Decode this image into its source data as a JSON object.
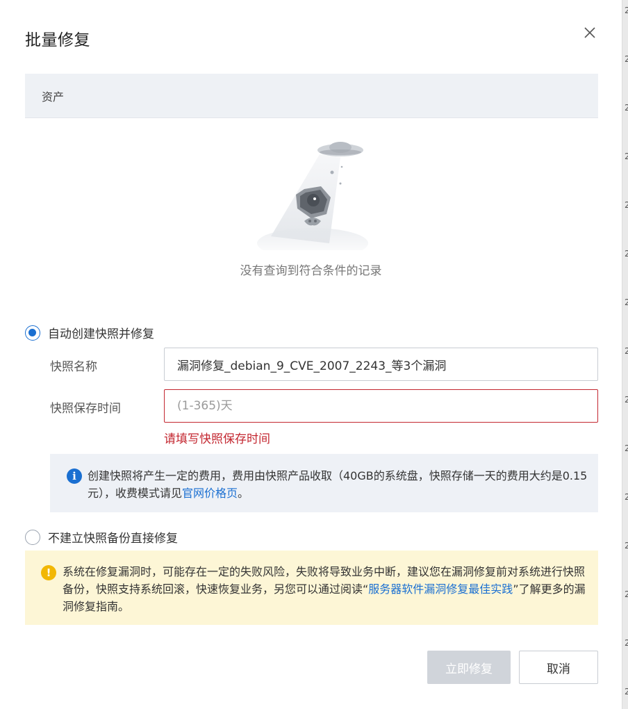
{
  "dialog": {
    "title": "批量修复",
    "close_icon": "close-icon"
  },
  "table": {
    "column_header": "资产",
    "empty_text": "没有查询到符合条件的记录"
  },
  "options": {
    "auto_snapshot_label": "自动创建快照并修复",
    "auto_snapshot_selected": true,
    "no_snapshot_label": "不建立快照备份直接修复",
    "no_snapshot_selected": false
  },
  "snapshot_form": {
    "name_label": "快照名称",
    "name_value": "漏洞修复_debian_9_CVE_2007_2243_等3个漏洞",
    "retention_label": "快照保存时间",
    "retention_placeholder": "(1-365)天",
    "retention_value": "",
    "retention_error": "请填写快照保存时间"
  },
  "info_notice": {
    "icon": "info-icon",
    "text_before": "创建快照将产生一定的费用，费用由快照产品收取（40GB的系统盘，快照存储一天的费用大约是0.15元），收费模式请见",
    "link_text": "官网价格页",
    "text_after": "。"
  },
  "warning_notice": {
    "icon": "warning-icon",
    "text_before": "系统在修复漏洞时，可能存在一定的失败风险，失败将导致业务中断，建议您在漏洞修复前对系统进行快照备份，快照支持系统回滚，快速恢复业务，另您可以通过阅读“",
    "link_text": "服务器软件漏洞修复最佳实践",
    "text_after": "”了解更多的漏洞修复指南。"
  },
  "footer": {
    "confirm_label": "立即修复",
    "cancel_label": "取消"
  },
  "colors": {
    "accent": "#1a6fd1",
    "error": "#c3262f",
    "warning": "#f2b705",
    "disabled_button": "#d0d4da"
  }
}
